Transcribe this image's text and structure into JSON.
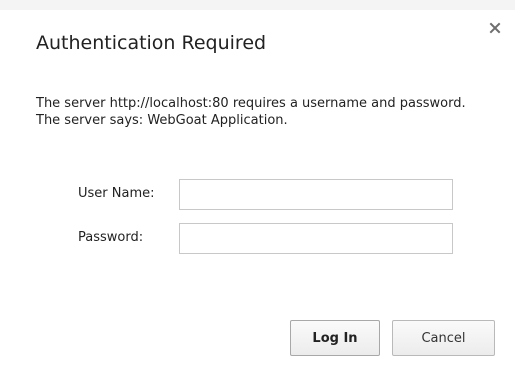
{
  "dialog": {
    "title": "Authentication Required",
    "message": "The server http://localhost:80 requires a username and password. The server says: WebGoat Application."
  },
  "form": {
    "username_label": "User Name:",
    "username_value": "",
    "password_label": "Password:",
    "password_value": ""
  },
  "buttons": {
    "login_label": "Log In",
    "cancel_label": "Cancel"
  },
  "icons": {
    "close": "close-icon"
  }
}
